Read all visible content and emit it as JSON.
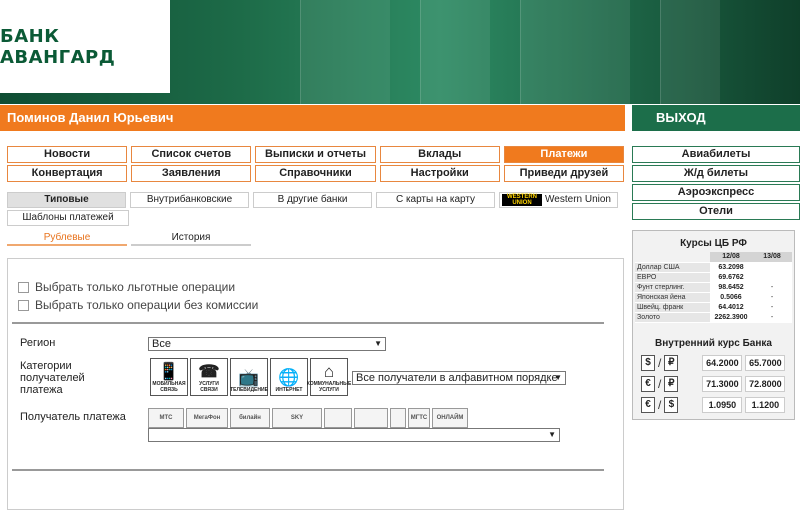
{
  "header": {
    "logo": "БАНК АВАНГАРД",
    "user": "Поминов Данил Юрьевич",
    "logout": "ВЫХОД"
  },
  "nav": {
    "row1": [
      "Новости",
      "Список счетов",
      "Выписки и отчеты",
      "Вклады",
      "Платежи"
    ],
    "row2": [
      "Конвертация",
      "Заявления",
      "Справочники",
      "Настройки",
      "Приведи друзей"
    ],
    "active": "Платежи"
  },
  "subtabs": [
    "Типовые",
    "Внутрибанковские",
    "В другие банки",
    "С карты на карту",
    "Western Union"
  ],
  "wu_logo": "WESTERN UNION",
  "templates": "Шаблоны платежей",
  "tabs2": [
    "Рублевые",
    "История"
  ],
  "form": {
    "chk1": "Выбрать только льготные операции",
    "chk2": "Выбрать только операции без комиссии",
    "region_label": "Регион",
    "region_value": "Все",
    "cat_label": [
      "Категории",
      "получателей",
      "платежа"
    ],
    "categories": [
      {
        "label": "МОБИЛЬНАЯ СВЯЗЬ",
        "icon": "phone-icon",
        "glyph": "📱"
      },
      {
        "label": "УСЛУГИ СВЯЗИ",
        "icon": "handset-icon",
        "glyph": "☎"
      },
      {
        "label": "ТЕЛЕВИДЕНИЕ",
        "icon": "tv-icon",
        "glyph": "📺"
      },
      {
        "label": "ИНТЕРНЕТ",
        "icon": "globe-icon",
        "glyph": "🌐"
      },
      {
        "label": "КОММУНАЛЬНЫЕ УСЛУГИ",
        "icon": "house-icon",
        "glyph": "⌂"
      }
    ],
    "sort_value": "Все получатели в алфавитном порядке",
    "recipient_label": "Получатель платежа",
    "operators": [
      "МТС",
      "МегаФон",
      "билайн",
      "SKY",
      "",
      "",
      "",
      "МГТС",
      "ОНЛАЙМ"
    ]
  },
  "right": {
    "links": [
      "Авиабилеты",
      "Ж/д билеты",
      "Аэроэкспресс",
      "Отели"
    ],
    "rates_title": "Курсы ЦБ РФ",
    "dates": [
      "12/08",
      "13/08"
    ],
    "rates": [
      {
        "name": "Доллар США",
        "v1": "63.2098",
        "v2": ""
      },
      {
        "name": "ЕВРО",
        "v1": "69.6762",
        "v2": ""
      },
      {
        "name": "Фунт стерлинг.",
        "v1": "98.6452",
        "v2": "-"
      },
      {
        "name": "Японская йена",
        "v1": "0.5066",
        "v2": "-"
      },
      {
        "name": "Швейц. франк",
        "v1": "64.4012",
        "v2": "-"
      },
      {
        "name": "Золото",
        "v1": "2262.3900",
        "v2": "-"
      }
    ],
    "inner_title": "Внутренний курс Банка",
    "inner": [
      {
        "a": "$",
        "b": "₽",
        "buy": "64.2000",
        "sell": "65.7000"
      },
      {
        "a": "€",
        "b": "₽",
        "buy": "71.3000",
        "sell": "72.8000"
      },
      {
        "a": "€",
        "b": "$",
        "buy": "1.0950",
        "sell": "1.1200"
      }
    ]
  }
}
